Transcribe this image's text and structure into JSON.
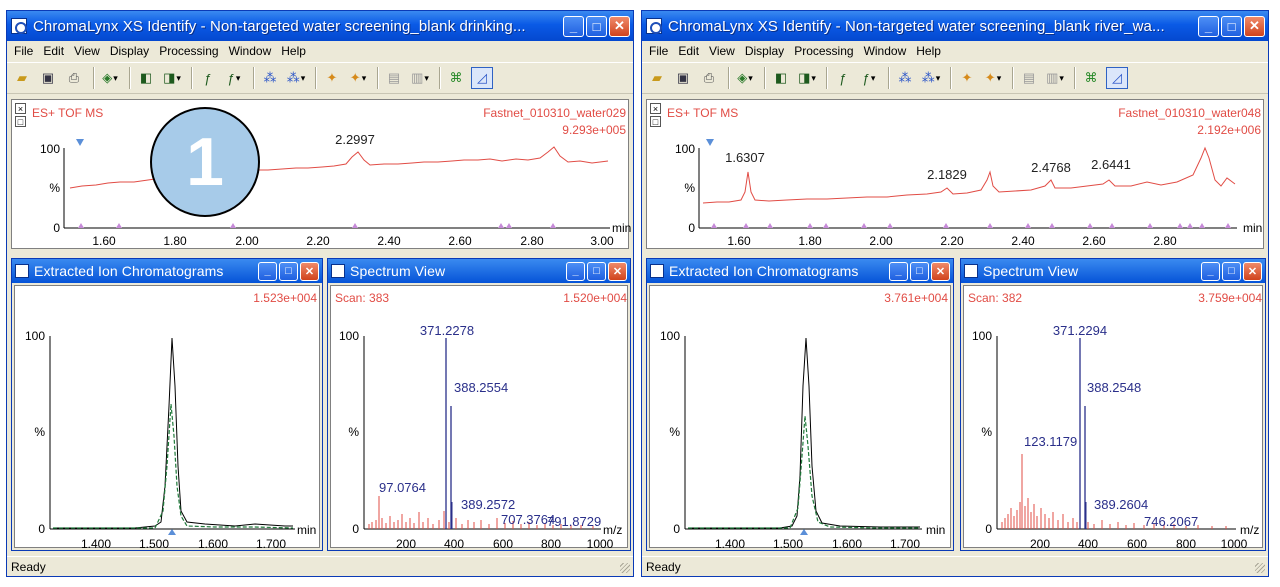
{
  "colors": {
    "title_blue": "#0a5ae6",
    "trace_red": "#e14c45",
    "mass_blue": "#2a2f8a",
    "eic_green": "#1f7a3a"
  },
  "menu": [
    "File",
    "Edit",
    "View",
    "Display",
    "Processing",
    "Window",
    "Help"
  ],
  "status_text": "Ready",
  "badge": "1",
  "windows": [
    {
      "title": "ChromaLynx XS Identify - Non-targeted water screening_blank drinking...",
      "tic": {
        "mode": "ES+ TOF MS",
        "file": "Fastnet_010310_water029",
        "intensity": "9.293e+005",
        "y_labels": [
          "100",
          "%",
          "0"
        ],
        "x_ticks": [
          "1.60",
          "1.80",
          "2.00",
          "2.20",
          "2.40",
          "2.60",
          "2.80",
          "3.00"
        ],
        "x_unit": "min",
        "peak_labels": [
          "2.2997"
        ]
      },
      "eic": {
        "title": "Extracted Ion Chromatograms",
        "intensity": "1.523e+004",
        "y_labels": [
          "100",
          "%",
          "0"
        ],
        "x_ticks": [
          "1.400",
          "1.500",
          "1.600",
          "1.700"
        ],
        "x_unit": "min"
      },
      "spectrum": {
        "title": "Spectrum View",
        "scan": "Scan: 383",
        "intensity": "1.520e+004",
        "y_labels": [
          "100",
          "%",
          "0"
        ],
        "x_ticks": [
          "200",
          "400",
          "600",
          "800",
          "1000"
        ],
        "x_unit": "m/z",
        "peaks": [
          "371.2278",
          "388.2554",
          "97.0764",
          "389.2572",
          "707.3764",
          "791.8729"
        ]
      }
    },
    {
      "title": "ChromaLynx XS Identify - Non-targeted water screening_blank river_wa...",
      "tic": {
        "mode": "ES+ TOF MS",
        "file": "Fastnet_010310_water048",
        "intensity": "2.192e+006",
        "y_labels": [
          "100",
          "%",
          "0"
        ],
        "x_ticks": [
          "1.60",
          "1.80",
          "2.00",
          "2.20",
          "2.40",
          "2.60",
          "2.80"
        ],
        "x_unit": "min",
        "peak_labels": [
          "1.6307",
          "2.1829",
          "2.4768",
          "2.6441"
        ]
      },
      "eic": {
        "title": "Extracted Ion Chromatograms",
        "intensity": "3.761e+004",
        "y_labels": [
          "100",
          "%",
          "0"
        ],
        "x_ticks": [
          "1.400",
          "1.500",
          "1.600",
          "1.700"
        ],
        "x_unit": "min"
      },
      "spectrum": {
        "title": "Spectrum View",
        "scan": "Scan: 382",
        "intensity": "3.759e+004",
        "y_labels": [
          "100",
          "%",
          "0"
        ],
        "x_ticks": [
          "200",
          "400",
          "600",
          "800",
          "1000"
        ],
        "x_unit": "m/z",
        "peaks": [
          "371.2294",
          "388.2548",
          "123.1179",
          "389.2604",
          "746.2067"
        ]
      }
    }
  ]
}
